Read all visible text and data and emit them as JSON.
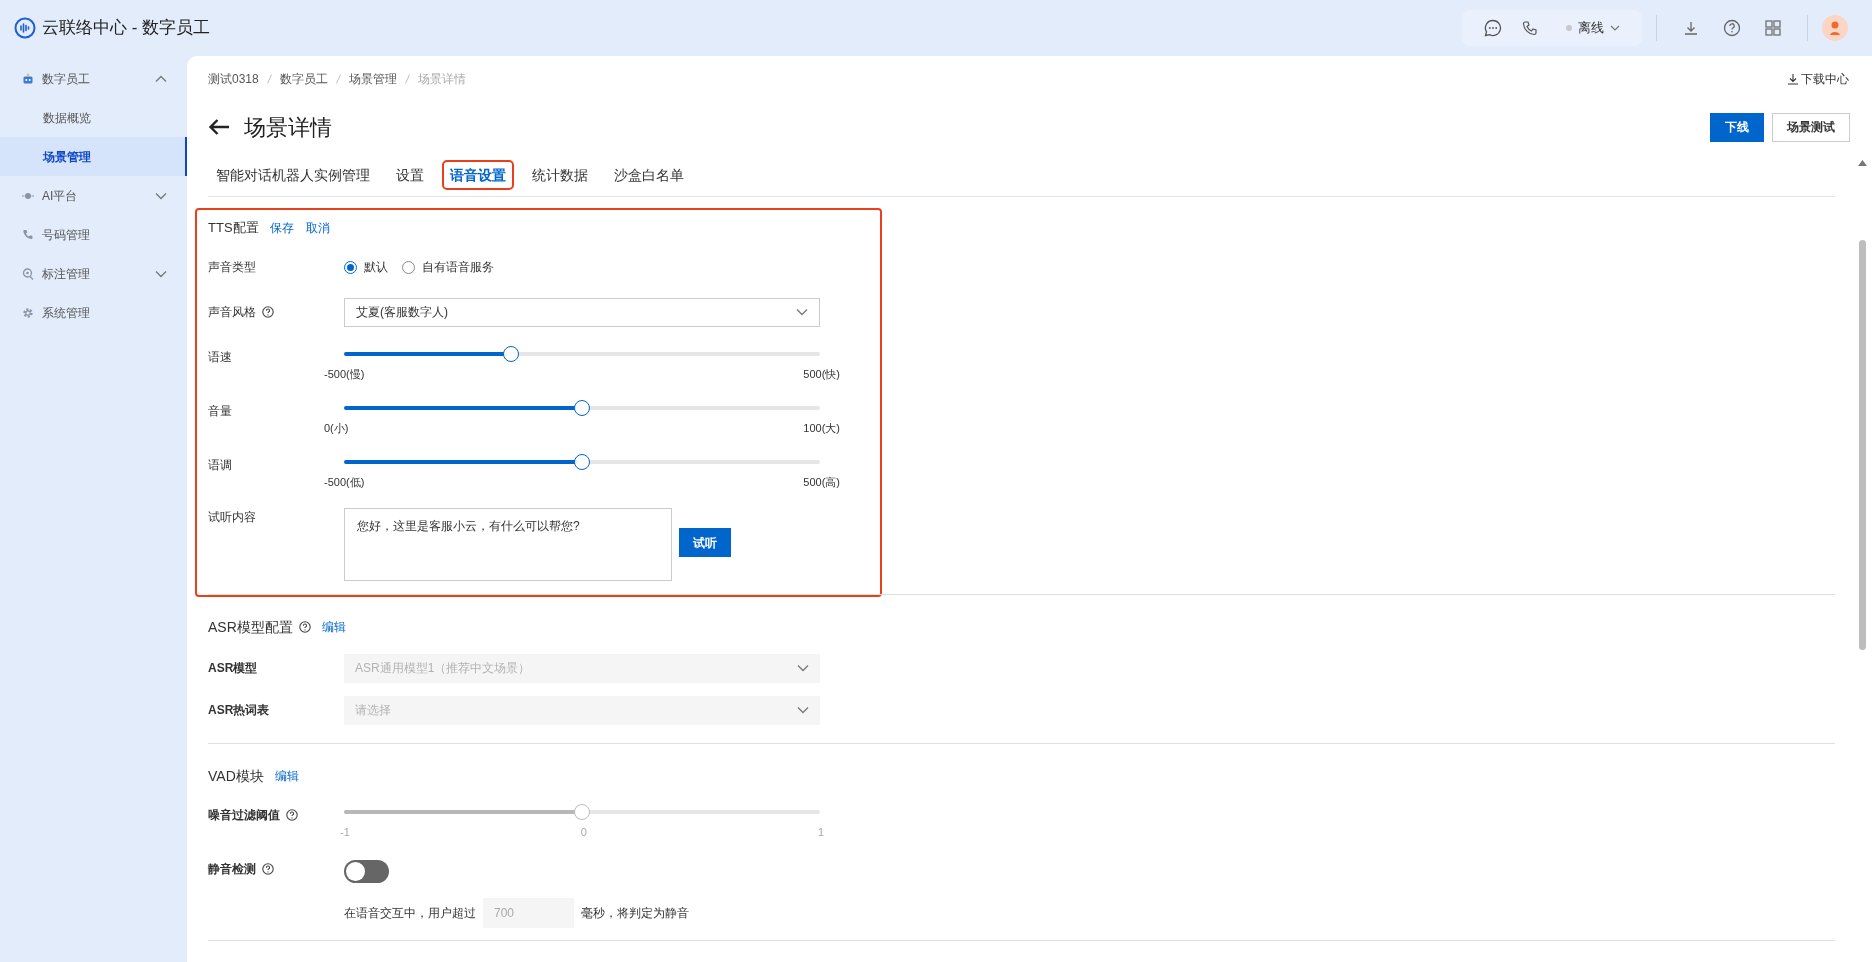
{
  "app": {
    "title": "云联络中心 - 数字员工"
  },
  "topbar": {
    "status": "离线"
  },
  "sidebar": {
    "items": [
      {
        "label": "数字员工",
        "kind": "group",
        "expanded": true,
        "selected": false,
        "children": [
          {
            "label": "数据概览",
            "selected": false
          },
          {
            "label": "场景管理",
            "selected": true
          }
        ]
      },
      {
        "label": "AI平台",
        "kind": "group",
        "expanded": false,
        "selected": false
      },
      {
        "label": "号码管理",
        "kind": "link",
        "selected": false
      },
      {
        "label": "标注管理",
        "kind": "group",
        "expanded": false,
        "selected": false
      },
      {
        "label": "系统管理",
        "kind": "link",
        "selected": false
      }
    ]
  },
  "breadcrumb": [
    "测试0318",
    "数字员工",
    "场景管理",
    "场景详情"
  ],
  "download_center": "下载中心",
  "page_title": "场景详情",
  "buttons": [
    {
      "label": "下线",
      "kind": "primary"
    },
    {
      "label": "场景测试",
      "kind": "default"
    }
  ],
  "tabs": [
    {
      "label": "智能对话机器人实例管理",
      "selected": false,
      "highlighted": false
    },
    {
      "label": "设置",
      "selected": false,
      "highlighted": false
    },
    {
      "label": "语音设置",
      "selected": true,
      "highlighted": true
    },
    {
      "label": "统计数据",
      "selected": false,
      "highlighted": false
    },
    {
      "label": "沙盒白名单",
      "selected": false,
      "highlighted": false
    }
  ],
  "sections": [
    {
      "title": "TTS配置",
      "highlighted": true,
      "actions": [
        "保存",
        "取消"
      ],
      "fields": [
        {
          "kind": "radio",
          "label": "声音类型",
          "options": [
            {
              "label": "默认",
              "selected": true
            },
            {
              "label": "自有语音服务",
              "selected": false
            }
          ]
        },
        {
          "kind": "select",
          "label": "声音风格",
          "help": true,
          "value": "艾夏(客服数字人)"
        },
        {
          "kind": "slider",
          "label": "语速",
          "level": 0.35,
          "ticks": [
            "-500(慢)",
            "500(快)"
          ]
        },
        {
          "kind": "slider",
          "label": "音量",
          "level": 0.5,
          "ticks": [
            "0(小)",
            "100(大)"
          ]
        },
        {
          "kind": "slider",
          "label": "语调",
          "level": 0.5,
          "ticks": [
            "-500(低)",
            "500(高)"
          ]
        },
        {
          "kind": "textarea",
          "label": "试听内容",
          "value": "您好，这里是客服小云，有什么可以帮您?",
          "button": "试听"
        }
      ]
    },
    {
      "title": "ASR模型配置",
      "help": true,
      "actions": [
        "编辑"
      ],
      "fields": [
        {
          "kind": "select",
          "label": "ASR模型",
          "disabled": true,
          "value": "ASR通用模型1（推荐中文场景）"
        },
        {
          "kind": "select",
          "label": "ASR热词表",
          "disabled": true,
          "placeholder": "请选择"
        }
      ]
    },
    {
      "title": "VAD模块",
      "actions": [
        "编辑"
      ],
      "fields": [
        {
          "kind": "slider",
          "label": "噪音过滤阈值",
          "help": true,
          "disabled": true,
          "level": 0.5,
          "ticks": [
            "-1",
            "0",
            "1"
          ]
        },
        {
          "kind": "switch",
          "label": "静音检测",
          "help": true,
          "on": false,
          "note_before": "在语音交互中，用户超过",
          "value": "700",
          "note_after": "毫秒，将判定为静音"
        }
      ]
    }
  ]
}
